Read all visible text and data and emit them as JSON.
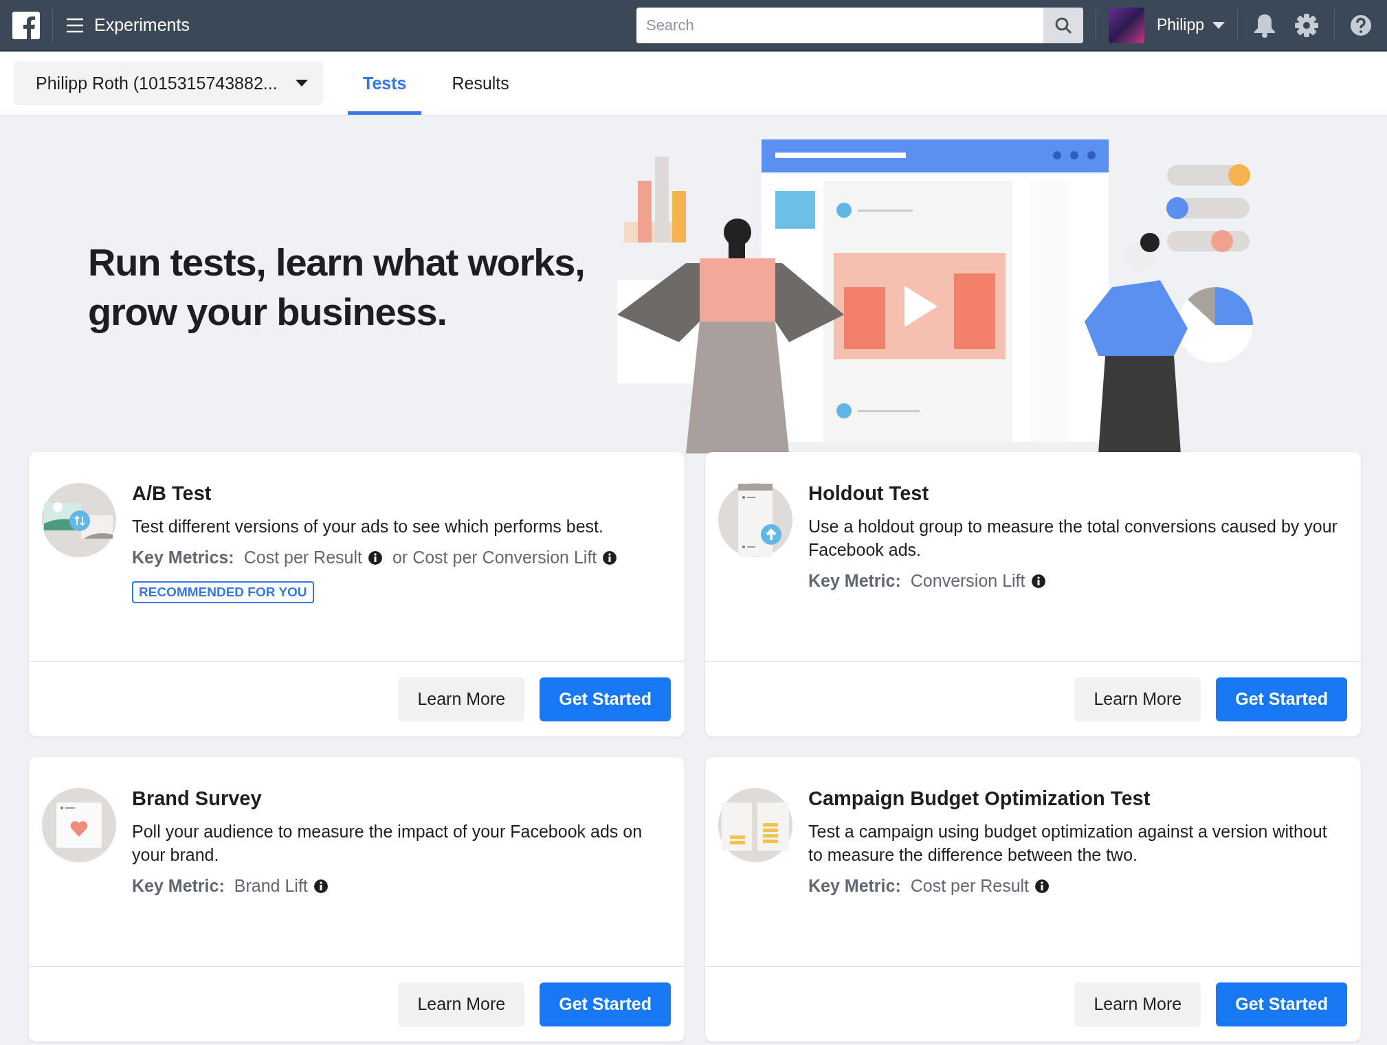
{
  "topbar": {
    "title": "Experiments",
    "search": {
      "placeholder": "Search"
    },
    "user": {
      "name": "Philipp"
    }
  },
  "account_selector": {
    "value": "Philipp Roth (1015315743882..."
  },
  "tabs": [
    {
      "label": "Tests",
      "selected": true
    },
    {
      "label": "Results",
      "selected": false
    }
  ],
  "hero": {
    "heading": "Run tests, learn what works, grow your business."
  },
  "cards": [
    {
      "kind": "ab",
      "title": "A/B Test",
      "description": "Test different versions of your ads to see which performs best.",
      "metrics_label": "Key Metrics:",
      "metrics": [
        "Cost per Result",
        "or Cost per Conversion Lift"
      ],
      "badge": "RECOMMENDED FOR YOU",
      "buttons": [
        "Learn More",
        "Get Started"
      ]
    },
    {
      "kind": "holdout",
      "title": "Holdout Test",
      "description": "Use a holdout group to measure the total conversions caused by your Facebook ads.",
      "metrics_label": "Key Metric:",
      "metrics": [
        "Conversion Lift"
      ],
      "buttons": [
        "Learn More",
        "Get Started"
      ]
    },
    {
      "kind": "survey",
      "title": "Brand Survey",
      "description": "Poll your audience to measure the impact of your Facebook ads on your brand.",
      "metrics_label": "Key Metric:",
      "metrics": [
        "Brand Lift"
      ],
      "buttons": [
        "Learn More",
        "Get Started"
      ]
    },
    {
      "kind": "budget",
      "title": "Campaign Budget Optimization Test",
      "description": "Test a campaign using budget optimization against a version without to measure the difference between the two.",
      "metrics_label": "Key Metric:",
      "metrics": [
        "Cost per Result"
      ],
      "buttons": [
        "Learn More",
        "Get Started"
      ]
    }
  ]
}
